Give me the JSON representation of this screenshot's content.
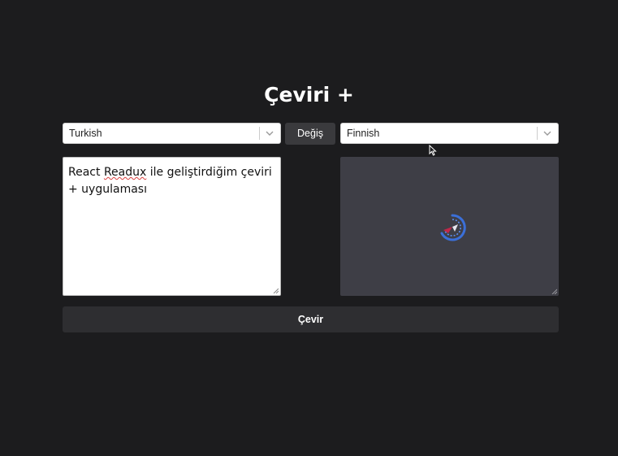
{
  "header": {
    "title": "Çeviri +"
  },
  "source_language": {
    "selected": "Turkish"
  },
  "target_language": {
    "selected": "Finnish"
  },
  "swap_button": {
    "label": "Değiş"
  },
  "source_text": {
    "before": "React ",
    "misspelled": "Readux",
    "after": " ile geliştirdiğim çeviri + uygulaması"
  },
  "output": {
    "state": "loading"
  },
  "translate_button": {
    "label": "Çevir"
  },
  "icons": {
    "dropdown": "chevron-down-icon",
    "loading": "spinner-icon",
    "resize": "resize-handle-icon",
    "cursor": "mouse-pointer-icon"
  },
  "colors": {
    "background": "#1c1c1e",
    "output_panel": "#3e3e46",
    "button": "#3a3a3d",
    "spinner": "#3b6fd8",
    "spinner_accent": "#c0284a"
  }
}
